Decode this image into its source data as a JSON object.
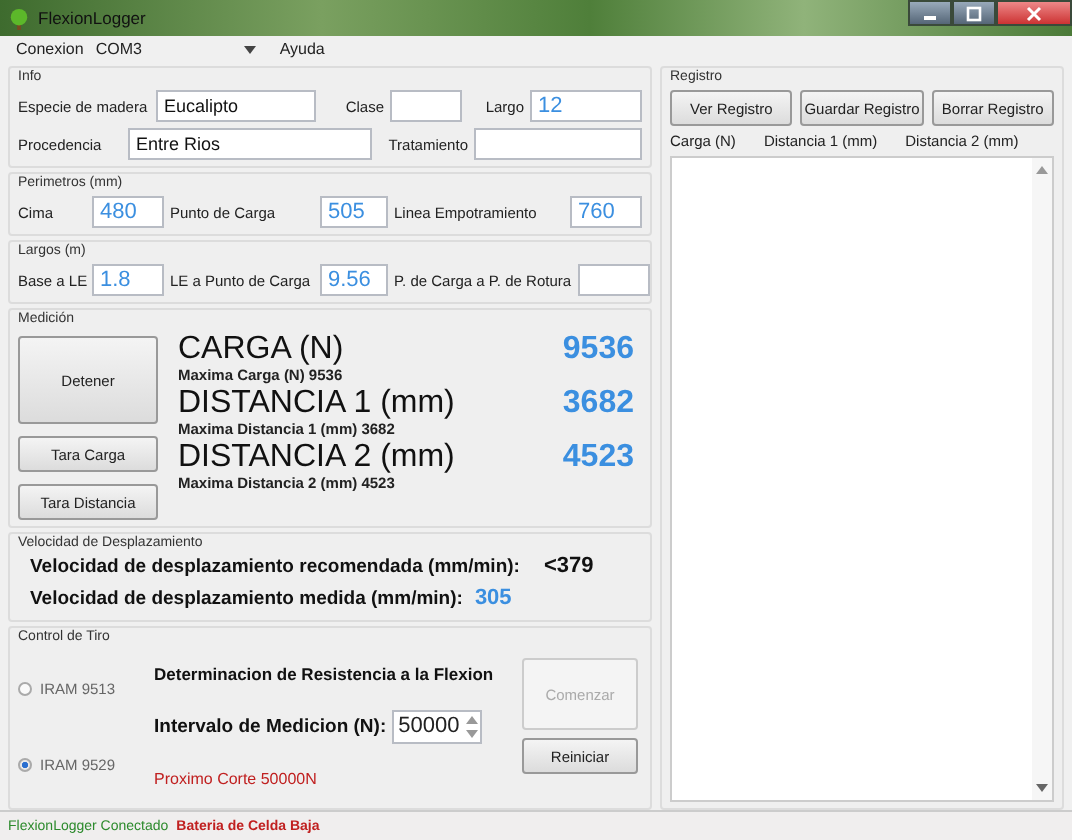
{
  "window": {
    "title": "FlexionLogger"
  },
  "menu": {
    "label": "Conexion",
    "port": "COM3",
    "help": "Ayuda"
  },
  "info": {
    "title": "Info",
    "rows": [
      [
        {
          "label": "Especie de madera",
          "value": "Eucalipto",
          "kind": "text"
        },
        {
          "label": "Clase",
          "kind": "text"
        },
        {
          "label": "Largo",
          "value": "12",
          "kind": "number"
        }
      ],
      [
        {
          "label": "Procedencia",
          "value": "Entre Rios",
          "kind": "text"
        },
        {
          "label": "Tratamiento",
          "kind": "text"
        }
      ]
    ]
  },
  "perimetros": {
    "title": "Perimetros (mm)",
    "fields": [
      {
        "label": "Cima",
        "value": "480",
        "kind": "number"
      },
      {
        "label": "Punto de Carga",
        "value": "505",
        "kind": "number"
      },
      {
        "label": "Linea Empotramiento",
        "value": "760",
        "kind": "number"
      }
    ]
  },
  "largos": {
    "title": "Largos (m)",
    "fields": [
      {
        "label": "Base a LE",
        "value": "1.8",
        "kind": "number"
      },
      {
        "label": "LE a Punto de Carga",
        "value": "9.56",
        "kind": "number"
      },
      {
        "label": "P. de Carga a P. de Rotura",
        "kind": "number"
      }
    ]
  },
  "medicion": {
    "title": "Medición",
    "buttons": [
      {
        "label": "Detener",
        "kind": "large"
      },
      {
        "label": "Tara Carga",
        "kind": "small"
      },
      {
        "label": "Tara Distancia",
        "kind": "small"
      }
    ],
    "readings": [
      {
        "title": "CARGA (N)",
        "value": "9536",
        "max": "Maxima Carga (N)  9536"
      },
      {
        "title": "DISTANCIA 1 (mm)",
        "value": "3682",
        "max": "Maxima Distancia 1 (mm)  3682"
      },
      {
        "title": "DISTANCIA 2 (mm)",
        "value": "4523",
        "max": "Maxima Distancia 2 (mm)  4523"
      }
    ]
  },
  "velocidad": {
    "title": "Velocidad de Desplazamiento",
    "rows": [
      {
        "label": "Velocidad de desplazamiento recomendada (mm/min):",
        "value": "<379",
        "kind": "reference"
      },
      {
        "label": "Velocidad de desplazamiento medida (mm/min):",
        "value": "305",
        "kind": "measured"
      }
    ]
  },
  "control": {
    "title": "Control de Tiro",
    "radios": [
      {
        "label": "IRAM 9513",
        "selected": false
      },
      {
        "label": "IRAM 9529",
        "selected": true
      }
    ],
    "heading": "Determinacion de Resistencia a la Flexion",
    "interval_label": "Intervalo de Medicion (N):",
    "interval_value": "50000",
    "next_cut": "Proximo Corte 50000N",
    "buttons": [
      {
        "label": "Comenzar",
        "disabled": true
      },
      {
        "label": "Reiniciar",
        "disabled": false
      }
    ]
  },
  "registro": {
    "title": "Registro",
    "buttons": [
      "Ver Registro",
      "Guardar Registro",
      "Borrar Registro"
    ],
    "columns": [
      "Carga (N)",
      "Distancia 1 (mm)",
      "Distancia 2 (mm)"
    ]
  },
  "status_bar": [
    {
      "text": "FlexionLogger Conectado",
      "kind": "ok"
    },
    {
      "text": "Bateria de Celda Baja",
      "kind": "warning"
    }
  ]
}
